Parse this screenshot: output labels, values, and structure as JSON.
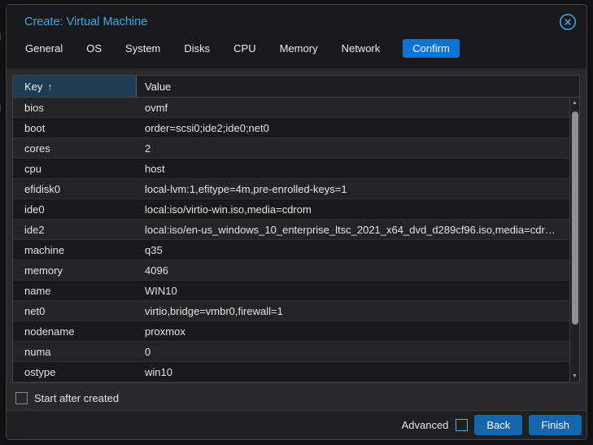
{
  "page": {
    "edge_fragments": [
      "al",
      "al"
    ]
  },
  "dialog": {
    "title": "Create: Virtual Machine",
    "tabs": [
      {
        "label": "General",
        "active": false
      },
      {
        "label": "OS",
        "active": false
      },
      {
        "label": "System",
        "active": false
      },
      {
        "label": "Disks",
        "active": false
      },
      {
        "label": "CPU",
        "active": false
      },
      {
        "label": "Memory",
        "active": false
      },
      {
        "label": "Network",
        "active": false
      },
      {
        "label": "Confirm",
        "active": true
      }
    ],
    "table": {
      "columns": [
        {
          "label": "Key",
          "sort": "asc",
          "sort_icon": "↑"
        },
        {
          "label": "Value"
        }
      ],
      "rows": [
        {
          "key": "bios",
          "value": "ovmf"
        },
        {
          "key": "boot",
          "value": "order=scsi0;ide2;ide0;net0"
        },
        {
          "key": "cores",
          "value": "2"
        },
        {
          "key": "cpu",
          "value": "host"
        },
        {
          "key": "efidisk0",
          "value": "local-lvm:1,efitype=4m,pre-enrolled-keys=1"
        },
        {
          "key": "ide0",
          "value": "local:iso/virtio-win.iso,media=cdrom"
        },
        {
          "key": "ide2",
          "value": "local:iso/en-us_windows_10_enterprise_ltsc_2021_x64_dvd_d289cf96.iso,media=cdr…"
        },
        {
          "key": "machine",
          "value": "q35"
        },
        {
          "key": "memory",
          "value": "4096"
        },
        {
          "key": "name",
          "value": "WIN10"
        },
        {
          "key": "net0",
          "value": "virtio,bridge=vmbr0,firewall=1"
        },
        {
          "key": "nodename",
          "value": "proxmox"
        },
        {
          "key": "numa",
          "value": "0"
        },
        {
          "key": "ostype",
          "value": "win10"
        }
      ]
    },
    "start_checkbox": {
      "label": "Start after created",
      "checked": false
    },
    "footer": {
      "advanced_label": "Advanced",
      "advanced_checked": false,
      "back_label": "Back",
      "finish_label": "Finish"
    }
  },
  "icons": {
    "close": "circle-x",
    "sort_asc": "↑",
    "scroll_up": "▲",
    "scroll_down": "▼"
  },
  "colors": {
    "accent_blue": "#0e73d2",
    "button_blue": "#1465ad",
    "title_blue": "#40a8e0",
    "sorted_header_bg": "#1f3d51",
    "row_light": "#232425",
    "row_dark": "#18191a"
  }
}
